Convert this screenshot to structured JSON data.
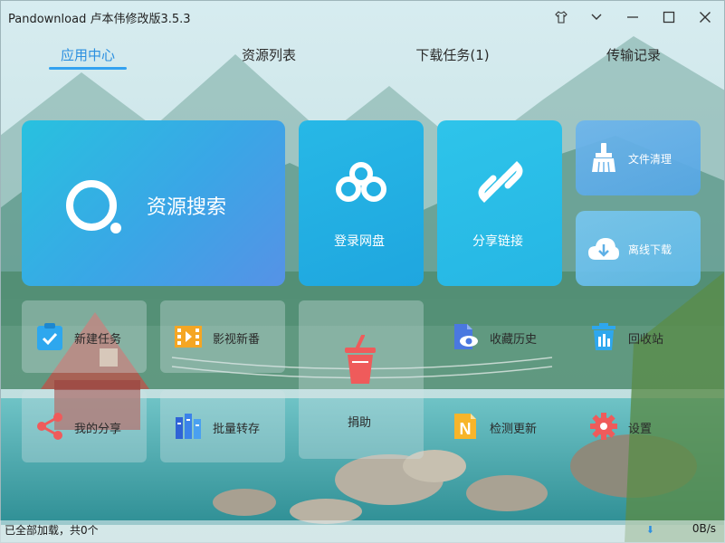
{
  "app": {
    "title": "Pandownload 卢本伟修改版3.5.3"
  },
  "window_controls": {
    "shirt_icon": "shirt-icon",
    "dropdown_icon": "chevron-down-icon",
    "minimize_icon": "minimize-icon",
    "maximize_icon": "maximize-icon",
    "close_icon": "close-icon"
  },
  "tabs": [
    {
      "label": "应用中心",
      "active": true
    },
    {
      "label": "资源列表",
      "active": false
    },
    {
      "label": "下载任务(1)",
      "active": false
    },
    {
      "label": "传输记录",
      "active": false
    }
  ],
  "cards": {
    "search": {
      "label": "资源搜索",
      "icon": "search-icon"
    },
    "login": {
      "label": "登录网盘",
      "icon": "cloud-icon"
    },
    "share": {
      "label": "分享链接",
      "icon": "link-icon"
    },
    "clean": {
      "label": "文件清理",
      "icon": "broom-icon"
    },
    "offline": {
      "label": "离线下载",
      "icon": "cloud-download-icon"
    }
  },
  "tiles": {
    "new_task": {
      "label": "新建任务",
      "icon": "clipboard-check-icon"
    },
    "video": {
      "label": "影视新番",
      "icon": "film-icon"
    },
    "donate": {
      "label": "捐助",
      "icon": "cup-icon"
    },
    "favorites": {
      "label": "收藏历史",
      "icon": "document-eye-icon"
    },
    "recycle": {
      "label": "回收站",
      "icon": "trash-icon"
    },
    "my_share": {
      "label": "我的分享",
      "icon": "share-icon"
    },
    "batch": {
      "label": "批量转存",
      "icon": "batch-save-icon"
    },
    "update": {
      "label": "检测更新",
      "icon": "update-n-icon"
    },
    "settings": {
      "label": "设置",
      "icon": "gear-icon"
    }
  },
  "status": {
    "left": "已全部加载，共0个",
    "speed": "0B/s",
    "arrow_icon": "download-arrow-icon"
  },
  "colors": {
    "accent": "#2b8fe0",
    "search_card": "#3aa6e6",
    "login_card": "#1fa6df",
    "share_card": "#26b6e4"
  }
}
